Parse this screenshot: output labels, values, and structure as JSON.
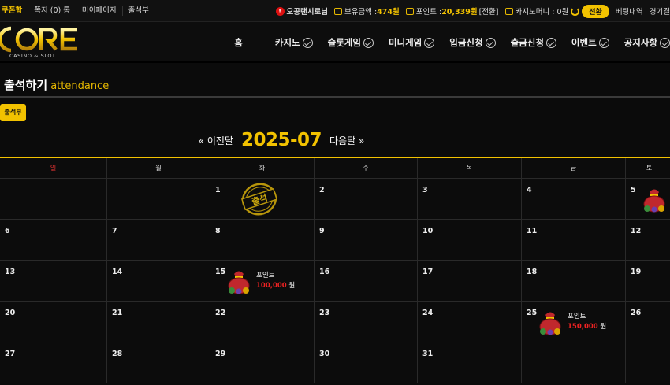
{
  "topbar": {
    "coupon": "쿠폰함",
    "message": "쪽지 (0) 통",
    "mypage": "마이페이지",
    "attendance": "출석부",
    "user_name": "오공랜시로님",
    "balance_label": "보유금액 : ",
    "balance_value": "474원",
    "point_label": "포인트 : ",
    "point_value": "20,339원",
    "point_convert": "[전환]",
    "casino_money_label": "카지노머니 : 0원",
    "convert_button": "전환",
    "betting_history": "베팅내역",
    "game_result": "경기결"
  },
  "logo": {
    "main": "CORE",
    "sub": "CASINO & SLOT"
  },
  "nav": {
    "items": [
      {
        "label": "홈",
        "check": false
      },
      {
        "label": "카지노",
        "check": true
      },
      {
        "label": "슬롯게임",
        "check": true
      },
      {
        "label": "미니게임",
        "check": true
      },
      {
        "label": "입금신청",
        "check": true
      },
      {
        "label": "출금신청",
        "check": true
      },
      {
        "label": "이벤트",
        "check": true
      },
      {
        "label": "공지사항",
        "check": true
      }
    ]
  },
  "page": {
    "title": "출석하기",
    "title_en": "attendance",
    "attendance_button": "출석부"
  },
  "calendar": {
    "prev": "« 이전달",
    "year_month": "2025-07",
    "next": "다음달 »",
    "weekdays": [
      "일",
      "월",
      "화",
      "수",
      "목",
      "금",
      "토"
    ],
    "stamp_text": "출석",
    "weeks": [
      [
        "",
        "",
        "1",
        "2",
        "3",
        "4",
        "5"
      ],
      [
        "6",
        "7",
        "8",
        "9",
        "10",
        "11",
        "12"
      ],
      [
        "13",
        "14",
        "15",
        "16",
        "17",
        "18",
        "19"
      ],
      [
        "20",
        "21",
        "22",
        "23",
        "24",
        "25",
        "26"
      ],
      [
        "27",
        "28",
        "29",
        "30",
        "31",
        "",
        ""
      ]
    ],
    "rewards": [
      {
        "day": "15",
        "label": "포인트",
        "amount": "100,000",
        "unit": "원"
      },
      {
        "day": "25",
        "label": "포인트",
        "amount": "150,000",
        "unit": "원"
      }
    ],
    "bag_only_days": [
      "5"
    ]
  },
  "colors": {
    "accent": "#f2c200",
    "sunday": "#e33",
    "amount": "#e22"
  }
}
